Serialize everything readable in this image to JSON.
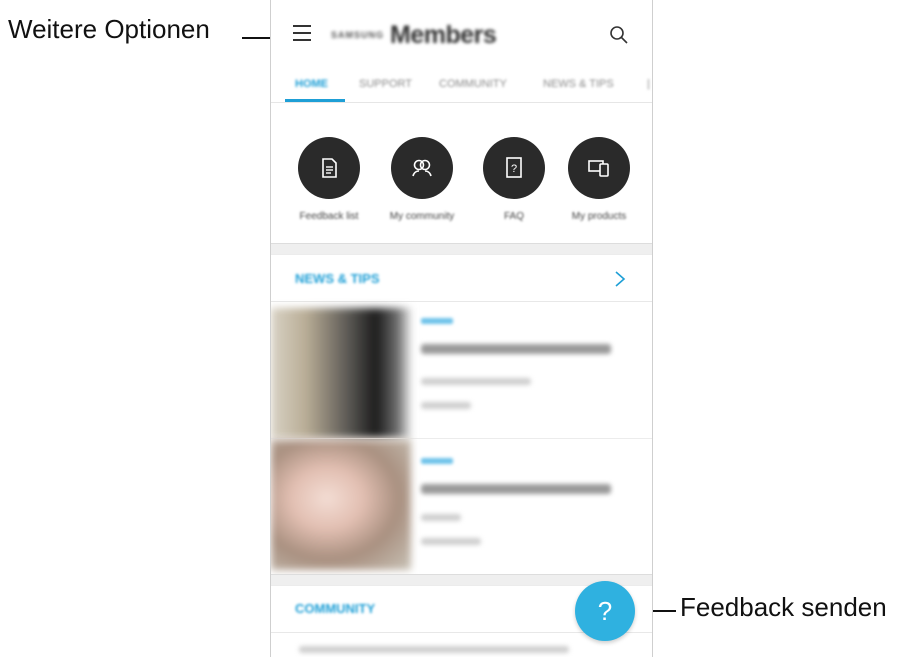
{
  "callouts": {
    "more_options": "Weitere Optionen",
    "send_feedback": "Feedback senden"
  },
  "app": {
    "brand": "SAMSUNG",
    "title": "Members"
  },
  "tabs": [
    "HOME",
    "SUPPORT",
    "COMMUNITY",
    "NEWS & TIPS"
  ],
  "active_tab": "HOME",
  "quick_actions": [
    {
      "label": "Feedback list",
      "icon": "document-icon"
    },
    {
      "label": "My community",
      "icon": "people-icon"
    },
    {
      "label": "FAQ",
      "icon": "faq-icon"
    },
    {
      "label": "My products",
      "icon": "devices-icon"
    }
  ],
  "sections": {
    "news": "NEWS & TIPS",
    "community": "COMMUNITY"
  },
  "fab": {
    "label": "?"
  },
  "colors": {
    "accent": "#1e9fd6",
    "fab": "#2fb1e0",
    "circle": "#2a2a2a"
  }
}
